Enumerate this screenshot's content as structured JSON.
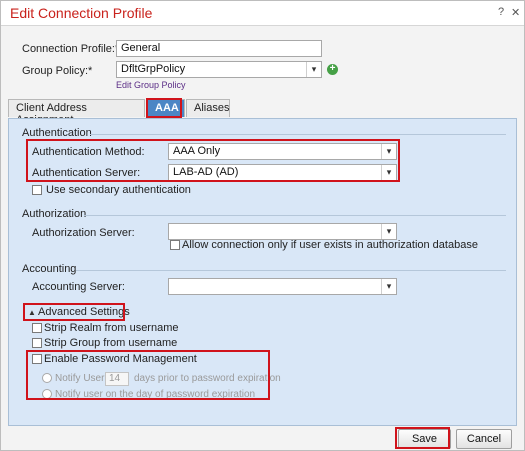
{
  "window": {
    "title": "Edit Connection Profile",
    "help": "?",
    "close": "✕"
  },
  "form": {
    "connection_profile_label": "Connection Profile:*",
    "connection_profile_value": "General",
    "group_policy_label": "Group Policy:*",
    "group_policy_value": "DfltGrpPolicy",
    "edit_group_policy_link": "Edit Group Policy"
  },
  "tabs": [
    {
      "label": "Client Address Assignment",
      "active": false
    },
    {
      "label": "AAA",
      "active": true
    },
    {
      "label": "Aliases",
      "active": false
    }
  ],
  "authentication": {
    "section_title": "Authentication",
    "method_label": "Authentication Method:",
    "method_value": "AAA Only",
    "server_label": "Authentication Server:",
    "server_value": "LAB-AD (AD)",
    "secondary_label": "Use secondary authentication"
  },
  "authorization": {
    "section_title": "Authorization",
    "server_label": "Authorization Server:",
    "server_value": "",
    "only_if_exists_label": "Allow connection only if user exists in authorization database"
  },
  "accounting": {
    "section_title": "Accounting",
    "server_label": "Accounting Server:",
    "server_value": ""
  },
  "advanced": {
    "title": "Advanced Settings",
    "strip_realm_label": "Strip Realm from username",
    "strip_group_label": "Strip Group from username",
    "password_mgmt_label": "Enable Password Management",
    "notify_user_label": "Notify User",
    "notify_days_value": "14",
    "notify_days_suffix": "days prior to password expiration",
    "notify_on_day_label": "Notify user on the day of password expiration"
  },
  "buttons": {
    "save": "Save",
    "cancel": "Cancel"
  },
  "colors": {
    "title": "#c9221c",
    "highlight": "#d0131b",
    "tab_active": "#4b86c5",
    "panel": "#d9e7f7"
  }
}
